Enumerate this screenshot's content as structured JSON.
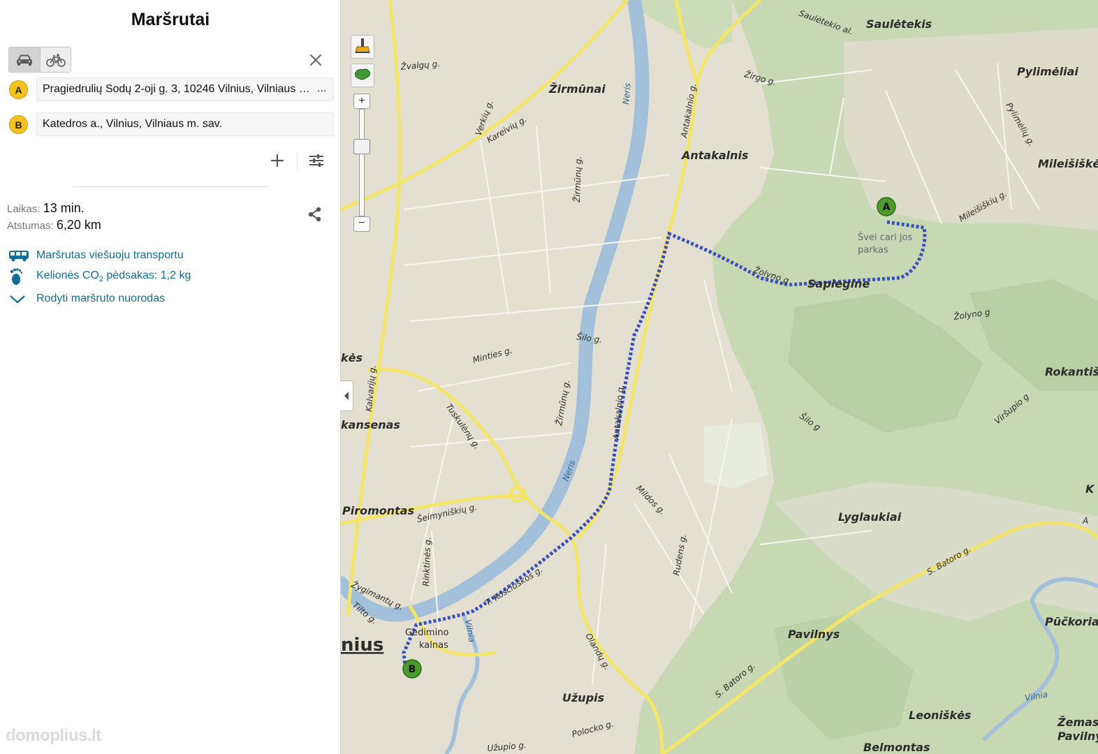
{
  "panel": {
    "title": "Maršrutai",
    "modes": [
      {
        "name": "car",
        "icon": "car-icon",
        "active": true
      },
      {
        "name": "bicycle",
        "icon": "bicycle-icon",
        "active": false
      }
    ],
    "waypoints": [
      {
        "badge": "A",
        "value": "Pragiedrulių Sodų 2-oji g. 3, 10246 Vilnius, Vilniaus m. sav.",
        "more": "..."
      },
      {
        "badge": "B",
        "value": "Katedros a., Vilnius, Vilniaus m. sav."
      }
    ],
    "time_label": "Laikas:",
    "time_value": "13 min.",
    "distance_label": "Atstumas:",
    "distance_value": "6,20 km",
    "links": {
      "public_transport": "Maršrutas viešuoju transportu",
      "co2_prefix": "Kelionės CO",
      "co2_sub": "2",
      "co2_suffix": " pėdsakas: 1,2 kg",
      "directions": "Rodyti maršruto nuorodas"
    },
    "watermark": "domoplius.lt"
  },
  "map": {
    "colors": {
      "land": "#e4e0d1",
      "forest": "#c4d5b0",
      "forest_light": "#d2ddc0",
      "river": "#9ebcd7",
      "road_major": "#f5e86a",
      "route": "#3a4fc0"
    },
    "markers": [
      {
        "label": "A"
      },
      {
        "label": "B"
      }
    ],
    "labels": {
      "sauletekis": "Saulėtekis",
      "sauletekio_al": "Saulėtekio al.",
      "pylimeliai": "Pylimėliai",
      "mileisiskes": "Mileišiškė",
      "mileisiskiu_g": "Mileišiškių g.",
      "pylimeliu_g": "Pylimėlių g.",
      "zirgo_g": "Žirgo g.",
      "zirmunai": "Žirmūnai",
      "zvalgu_g": "Žvalgų g.",
      "verkiu_g": "Verkių g.",
      "kareiviu_g": "Kareivių g.",
      "antakalnis": "Antakalnis",
      "antakalnio_g": "Antakalnio g.",
      "neris_top": "Neris",
      "zirmunu_g": "Žirmūnų g.",
      "park": "Švei cari jos",
      "park2": "parkas",
      "sapiegine": "Sapiegine",
      "zolyno_g": "Žolyno g",
      "zolyno_g2": "Žolyno g",
      "silo_g": "Šilo g.",
      "silo_g2": "Šilo g",
      "minties_g": "Minties g.",
      "zirmunu_g2": "Žirmūnų g.",
      "rokantiskes": "Rokantiš",
      "virsupio_g": "Viršupio g",
      "antakalnio_g2": "Antakalnio g.",
      "kes": "kės",
      "kalvariju_g": "Kalvarijų g.",
      "kansenas": "kansenas",
      "tuskulenu_g": "Tuskulėnų g.",
      "neris_mid": "Neris",
      "mildos_g": "Mildos g.",
      "lyglaukiai": "Lyglaukiai",
      "piromontas": "Piromontas",
      "seimyniskiu_g": "Šeimyniškių g.",
      "rudens_g": "Rudens g.",
      "batoro_g": "S. Batoro g.",
      "batoro_g2": "S. Batoro g.",
      "rinktines_g": "Rinktinės g.",
      "kosciuskos_g": "T. Kosciuškos g.",
      "zygimantu_g": "Žygimantų g.",
      "tilto_g": "Tilto g.",
      "gedimino": "Gedimino",
      "kalnas": "kalnas",
      "vilnia": "Vilnia",
      "vilnius": "nius",
      "pavilnys": "Pavilnys",
      "puckoriai": "Pūčkoriai",
      "olandu_g": "Olandų g.",
      "uzupis": "Užupis",
      "leoniskes": "Leoniškės",
      "vilnia2": "Vilnia",
      "zemas": "Žemas",
      "pavilny": "Pavilny",
      "polocko_g": "Polocko g.",
      "uzupio_g": "Užupio g.",
      "belmontas": "Belmontas",
      "k_edge": "K",
      "a_edge": "A"
    }
  }
}
